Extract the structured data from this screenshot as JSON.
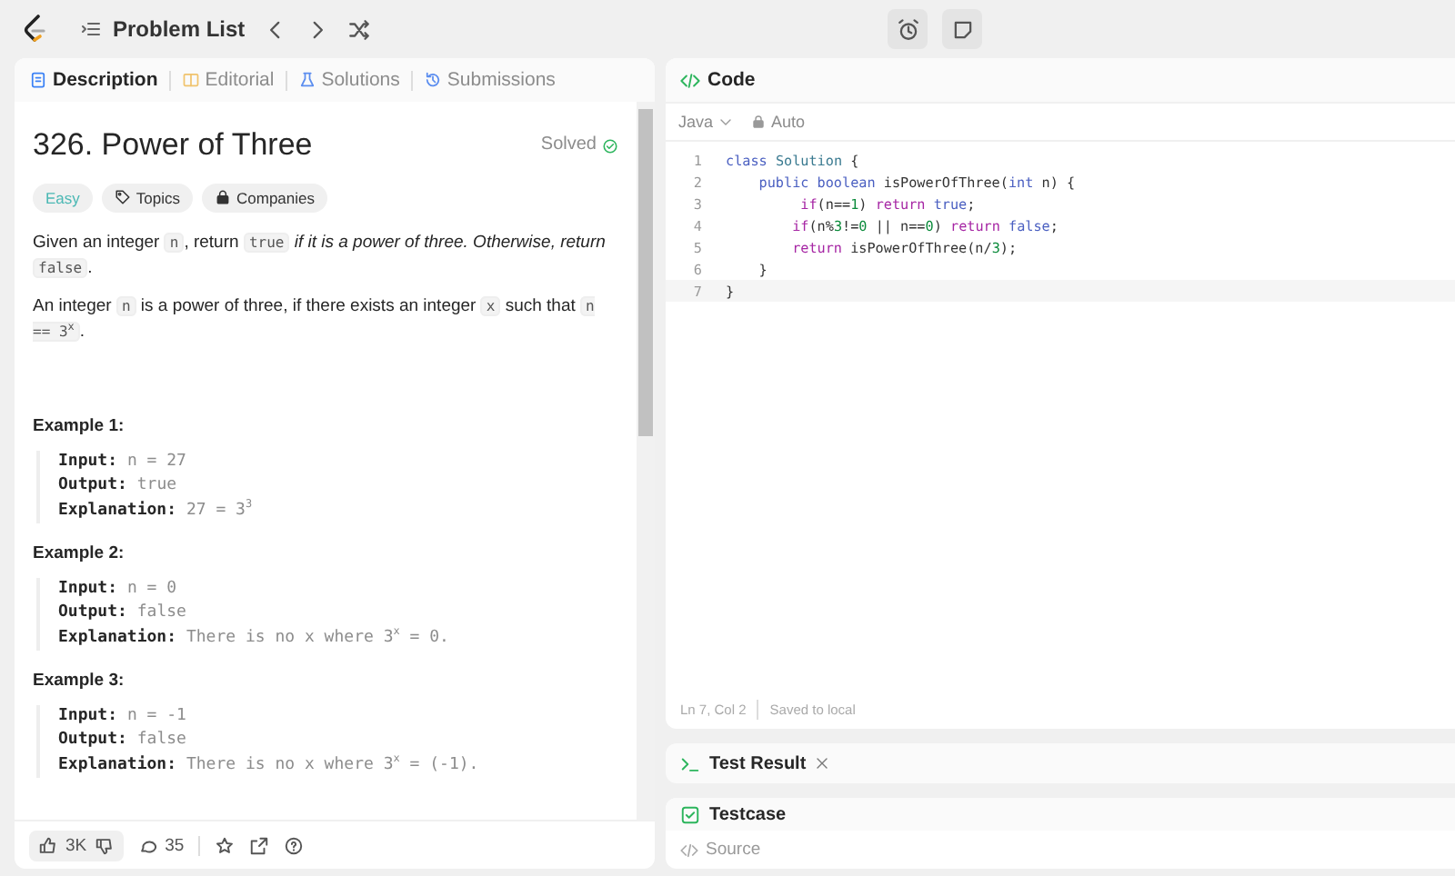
{
  "top_bar": {
    "title": "Problem List"
  },
  "description_panel": {
    "tabs": [
      {
        "label": "Description",
        "selected": true
      },
      {
        "label": "Editorial",
        "selected": false
      },
      {
        "label": "Solutions",
        "selected": false
      },
      {
        "label": "Submissions",
        "selected": false
      }
    ],
    "title": "326. Power of Three",
    "status": "Solved",
    "tags": [
      {
        "label": "Easy",
        "kind": "difficulty"
      },
      {
        "label": "Topics",
        "kind": "topics"
      },
      {
        "label": "Companies",
        "kind": "companies"
      }
    ],
    "paragraphs": [
      [
        {
          "kind": "text",
          "text": "Given an integer "
        },
        {
          "kind": "code",
          "text": "n"
        },
        {
          "kind": "text",
          "text": ", return "
        },
        {
          "kind": "code",
          "text": "true"
        },
        {
          "kind": "italic",
          "text": " if it is a power of three. Otherwise, return "
        },
        {
          "kind": "code",
          "text": "false"
        },
        {
          "kind": "text",
          "text": "."
        }
      ],
      [
        {
          "kind": "text",
          "text": "An integer "
        },
        {
          "kind": "code",
          "text": "n"
        },
        {
          "kind": "text",
          "text": " is a power of three, if there exists an integer "
        },
        {
          "kind": "code",
          "text": "x"
        },
        {
          "kind": "text",
          "text": " such that "
        },
        {
          "kind": "code",
          "text": "n == 3$^{x}$"
        },
        {
          "kind": "text",
          "text": "."
        }
      ]
    ],
    "examples": [
      {
        "title": "Example 1:",
        "lines": [
          {
            "label": "Input:",
            "value": "n = 27"
          },
          {
            "label": "Output:",
            "value": "true"
          },
          {
            "label": "Explanation:",
            "value": "27 = 3$^{3}$"
          }
        ]
      },
      {
        "title": "Example 2:",
        "lines": [
          {
            "label": "Input:",
            "value": "n = 0"
          },
          {
            "label": "Output:",
            "value": "false"
          },
          {
            "label": "Explanation:",
            "value": "There is no x where 3$^{x}$ = 0."
          }
        ]
      },
      {
        "title": "Example 3:",
        "lines": [
          {
            "label": "Input:",
            "value": "n = -1"
          },
          {
            "label": "Output:",
            "value": "false"
          },
          {
            "label": "Explanation:",
            "value": "There is no x where 3$^{x}$ = (-1)."
          }
        ]
      }
    ],
    "footer": {
      "likes": "3K",
      "comments": "35"
    }
  },
  "code_panel": {
    "title": "Code",
    "language": "Java",
    "mode": "Auto",
    "lines": [
      {
        "number": "1",
        "tokens": [
          {
            "kind": "keyword",
            "text": "class "
          },
          {
            "kind": "type",
            "text": "Solution "
          },
          {
            "kind": "plain",
            "text": "{"
          }
        ]
      },
      {
        "number": "2",
        "tokens": [
          {
            "kind": "keyword",
            "text": "    public boolean "
          },
          {
            "kind": "plain",
            "text": "isPowerOfThree("
          },
          {
            "kind": "keyword",
            "text": "int "
          },
          {
            "kind": "plain",
            "text": "n) {"
          }
        ]
      },
      {
        "number": "3",
        "tokens": [
          {
            "kind": "control",
            "text": "         if"
          },
          {
            "kind": "plain",
            "text": "(n=="
          },
          {
            "kind": "number",
            "text": "1"
          },
          {
            "kind": "plain",
            "text": ") "
          },
          {
            "kind": "control",
            "text": "return "
          },
          {
            "kind": "keyword",
            "text": "true"
          },
          {
            "kind": "plain",
            "text": ";"
          }
        ]
      },
      {
        "number": "4",
        "tokens": [
          {
            "kind": "control",
            "text": "        if"
          },
          {
            "kind": "plain",
            "text": "(n%"
          },
          {
            "kind": "number",
            "text": "3"
          },
          {
            "kind": "plain",
            "text": "!="
          },
          {
            "kind": "number",
            "text": "0"
          },
          {
            "kind": "plain",
            "text": " || n=="
          },
          {
            "kind": "number",
            "text": "0"
          },
          {
            "kind": "plain",
            "text": ") "
          },
          {
            "kind": "control",
            "text": "return "
          },
          {
            "kind": "keyword",
            "text": "false"
          },
          {
            "kind": "plain",
            "text": ";"
          }
        ]
      },
      {
        "number": "5",
        "tokens": [
          {
            "kind": "control",
            "text": "        return "
          },
          {
            "kind": "plain",
            "text": "isPowerOfThree(n/"
          },
          {
            "kind": "number",
            "text": "3"
          },
          {
            "kind": "plain",
            "text": ");"
          }
        ]
      },
      {
        "number": "6",
        "tokens": [
          {
            "kind": "plain",
            "text": "    }"
          }
        ]
      },
      {
        "number": "7",
        "tokens": [
          {
            "kind": "plain",
            "text": "}"
          }
        ]
      }
    ],
    "position": "Ln 7, Col 2",
    "save_status": "Saved to local"
  },
  "test_result": {
    "title": "Test Result"
  },
  "testcase": {
    "title": "Testcase",
    "source": "Source"
  }
}
